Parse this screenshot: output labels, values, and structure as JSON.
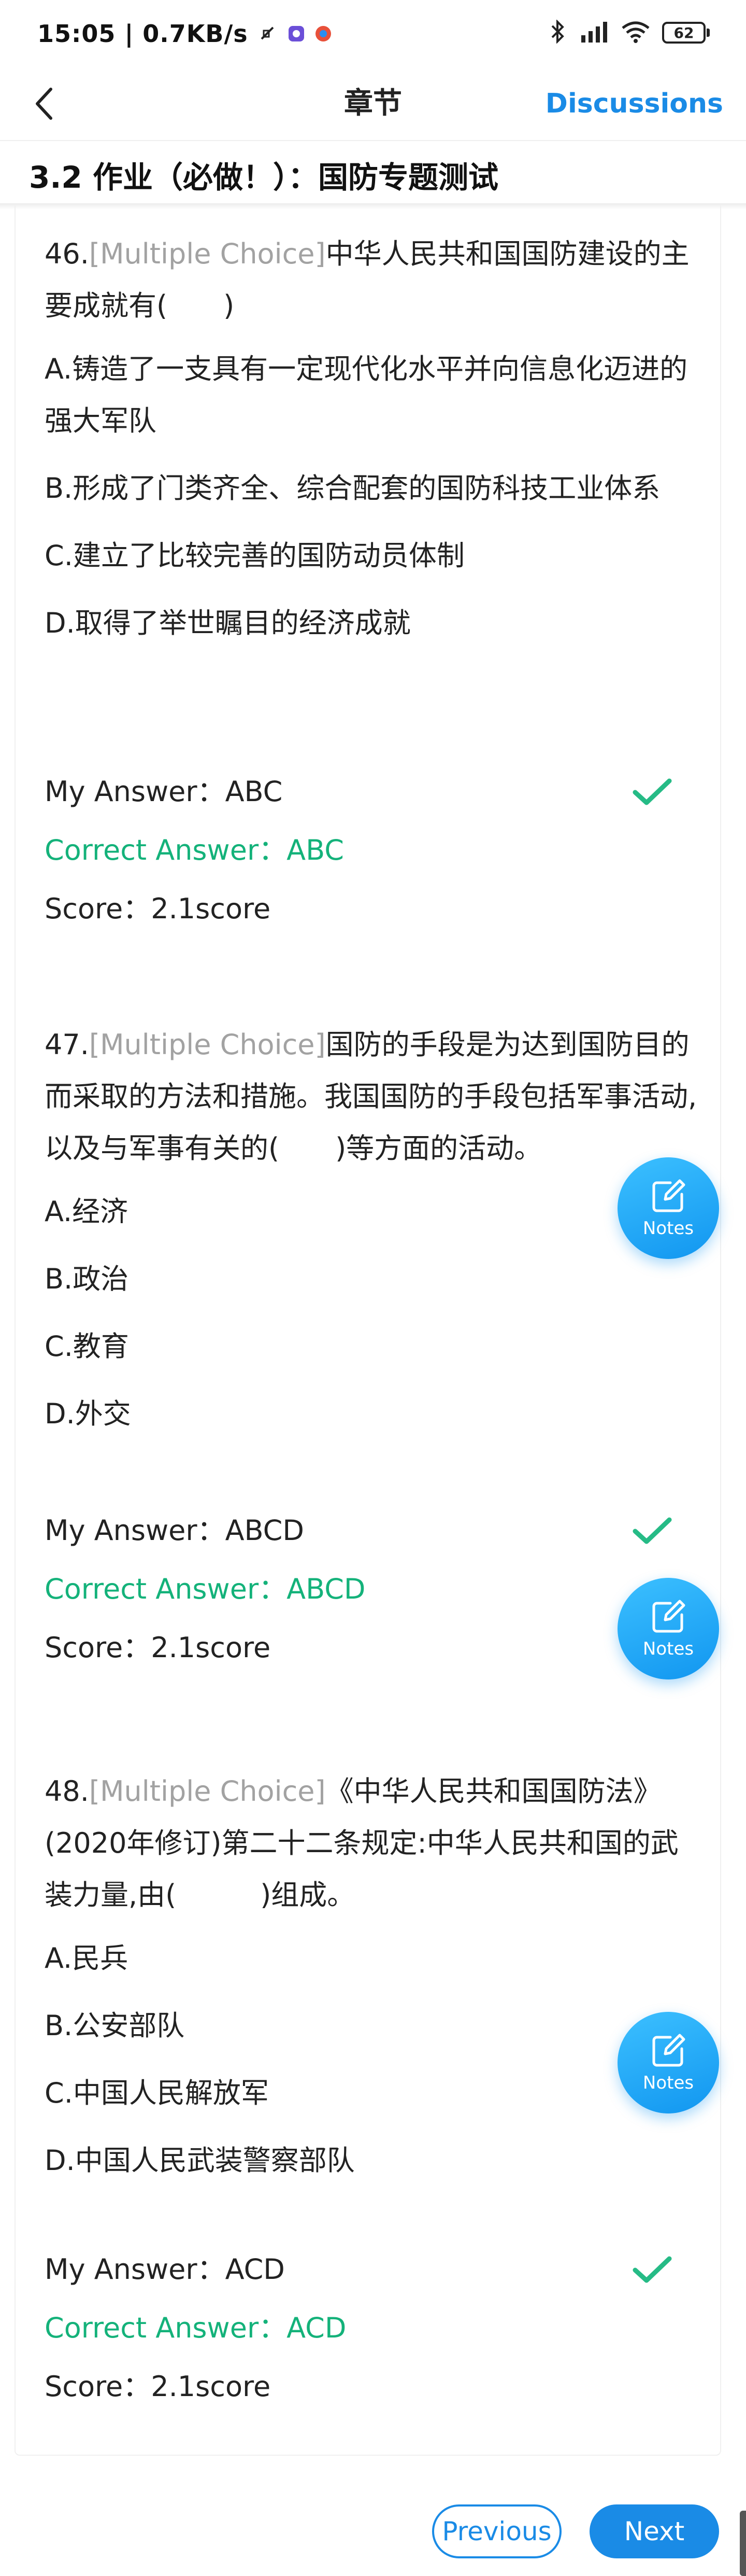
{
  "status_bar": {
    "time_speed": "15:05 | 0.7KB/s",
    "battery": "62"
  },
  "nav": {
    "title": "章节",
    "action": "Discussions"
  },
  "section_title": "3.2 作业（必做！）：国防专题测试",
  "labels": {
    "my_answer": "My Answer：",
    "correct_answer": "Correct Answer：",
    "score": "Score：",
    "notes": "Notes"
  },
  "questions": [
    {
      "number": "46.",
      "type": "[Multiple Choice]",
      "stem": "中华人民共和国国防建设的主要成就有(　　)",
      "options": [
        "A.铸造了一支具有一定现代化水平并向信息化迈进的强大军队",
        "B.形成了门类齐全、综合配套的国防科技工业体系",
        "C.建立了比较完善的国防动员体制",
        "D.取得了举世瞩目的经济成就"
      ],
      "my_answer": "ABC",
      "correct_answer": "ABC",
      "score": "2.1score"
    },
    {
      "number": "47.",
      "type": "[Multiple Choice]",
      "stem": "国防的手段是为达到国防目的而采取的方法和措施。我国国防的手段包括军事活动,以及与军事有关的(　　)等方面的活动。",
      "options": [
        "A.经济",
        "B.政治",
        "C.教育",
        "D.外交"
      ],
      "my_answer": "ABCD",
      "correct_answer": "ABCD",
      "score": "2.1score"
    },
    {
      "number": "48.",
      "type": "[Multiple Choice]",
      "stem": "《中华人民共和国国防法》(2020年修订)第二十二条规定:中华人民共和国的武装力量,由(　　　)组成。",
      "options": [
        "A.民兵",
        "B.公安部队",
        "C.中国人民解放军",
        "D.中国人民武装警察部队"
      ],
      "my_answer": "ACD",
      "correct_answer": "ACD",
      "score": "2.1score"
    }
  ],
  "buttons": {
    "previous": "Previous",
    "next": "Next"
  },
  "colors": {
    "accent": "#1a8be6",
    "correct": "#14b27a",
    "question_type": "#a2a2a2"
  }
}
